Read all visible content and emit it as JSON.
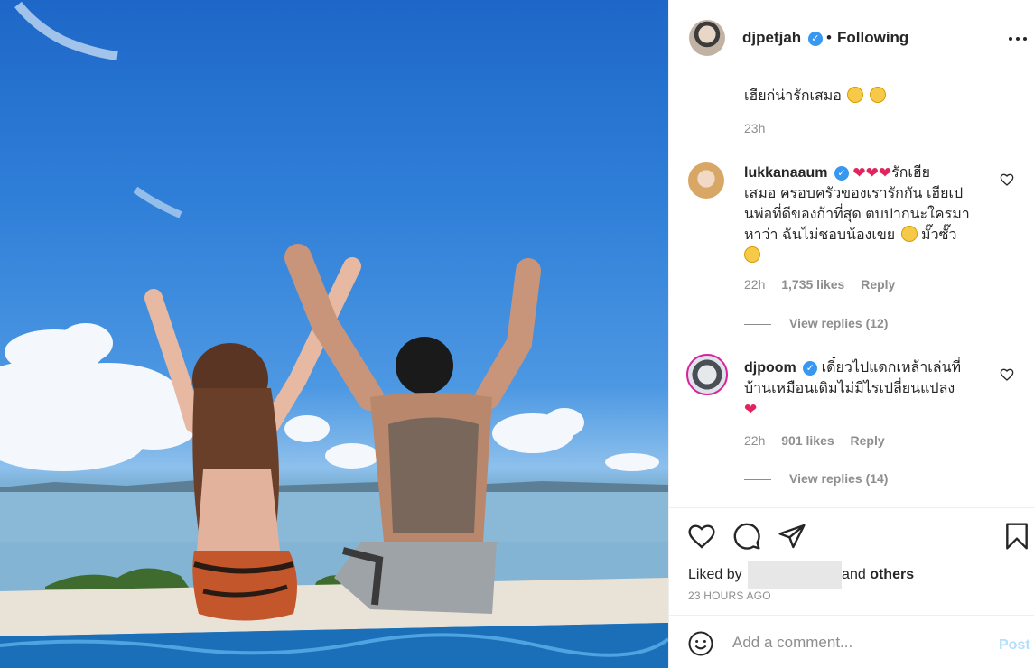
{
  "post": {
    "username": "djpetjah",
    "following_label": "Following",
    "dot": "•",
    "icons": {
      "verified": "verified-badge-icon",
      "more": "more-options-icon"
    }
  },
  "comments": [
    {
      "id": "caption-tail",
      "text": "เฮียก่น่ารักเสมอ",
      "emojis": [
        "grinning-face-icon",
        "smiling-face-with-hearts-icon"
      ],
      "time": "23h"
    },
    {
      "id": "lukkanaaum",
      "username": "lukkanaaum",
      "verified": true,
      "text_line1": "รักเฮีย",
      "text_line2": "เสมอ ครอบครัวของเรารักกัน เฮียเป",
      "text_line3": "นพ่อที่ดีของก้าที่สุด ตบปากนะใครมา",
      "text_line4": "หาว่า ฉันไม่ชอบน้องเขย",
      "text_line4_end": "มั๊วซั๊ว",
      "time": "22h",
      "likes": "1,735 likes",
      "reply": "Reply",
      "view_replies": "View replies (12)"
    },
    {
      "id": "djpoom",
      "username": "djpoom",
      "verified": true,
      "text_line1": "เดี๋ยวไปแดกเหล้าเล่นที่",
      "text_line2": "บ้านเหมือนเดิมไม่มีไรเปลี่ยนแปลง",
      "time": "22h",
      "likes": "901 likes",
      "reply": "Reply",
      "view_replies": "View replies (14)"
    }
  ],
  "actions": {
    "liked_prefix": "Liked by",
    "liked_and": "and",
    "liked_others": "others",
    "time_ago": "23 HOURS AGO"
  },
  "add_comment": {
    "placeholder": "Add a comment...",
    "post_label": "Post"
  },
  "colors": {
    "verified": "#3897f0",
    "heart_red": "#e0245e",
    "muted": "#8e8e8e",
    "post_disabled": "#b2dffc"
  }
}
